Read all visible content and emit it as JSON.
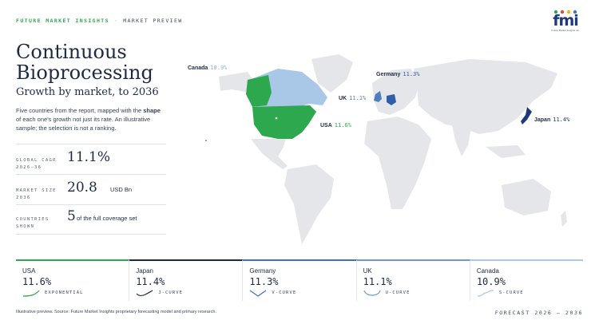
{
  "header": {
    "brand": "FUTURE MARKET INSIGHTS",
    "separator": "·",
    "section": "MARKET PREVIEW"
  },
  "logo": {
    "word": "fmi",
    "tagline": "Future Market Insights Inc."
  },
  "title": "Continuous Bioprocessing",
  "subtitle": "Growth by market, to 2036",
  "description_pre": "Five countries from the report, mapped with the ",
  "description_bold": "shape",
  "description_post": " of each one's growth not just its rate. An illustrative sample; the selection is not a ranking.",
  "stats": [
    {
      "label": "GLOBAL CAGR",
      "label2": "2026–36",
      "value": "11.1%",
      "unit": ""
    },
    {
      "label": "MARKET SIZE",
      "label2": "2036",
      "value": "20.8",
      "unit": "USD Bn"
    },
    {
      "label": "COUNTRIES",
      "label2": "SHOWN",
      "value": "5",
      "unit": "of the full coverage set"
    }
  ],
  "map_labels": [
    {
      "name": "Canada",
      "value": "10.9%"
    },
    {
      "name": "Germany",
      "value": "11.3%"
    },
    {
      "name": "UK",
      "value": "11.1%"
    },
    {
      "name": "USA",
      "value": "11.6%"
    },
    {
      "name": "Japan",
      "value": "11.4%"
    }
  ],
  "cards": [
    {
      "country": "USA",
      "value": "11.6%",
      "curve": "EXPONENTIAL",
      "color": "#2ea84f"
    },
    {
      "country": "Japan",
      "value": "11.4%",
      "curve": "J-CURVE",
      "color": "#1c2a44"
    },
    {
      "country": "Germany",
      "value": "11.3%",
      "curve": "V-CURVE",
      "color": "#3f74b8"
    },
    {
      "country": "UK",
      "value": "11.1%",
      "curve": "U-CURVE",
      "color": "#6e9bcc"
    },
    {
      "country": "Canada",
      "value": "10.9%",
      "curve": "S-CURVE",
      "color": "#a9c7e6"
    }
  ],
  "footer": "Illustrative preview. Source: Future Market Insights proprietary forecasting model and primary research.",
  "forecast": "FORECAST 2026 – 2036",
  "colors": {
    "usa": "#2ea84f",
    "canada": "#a9c7e6",
    "japan": "#1e3a78",
    "germany": "#2f5fa8",
    "uk": "#4f7fbf",
    "land": "#e4e6ea"
  }
}
